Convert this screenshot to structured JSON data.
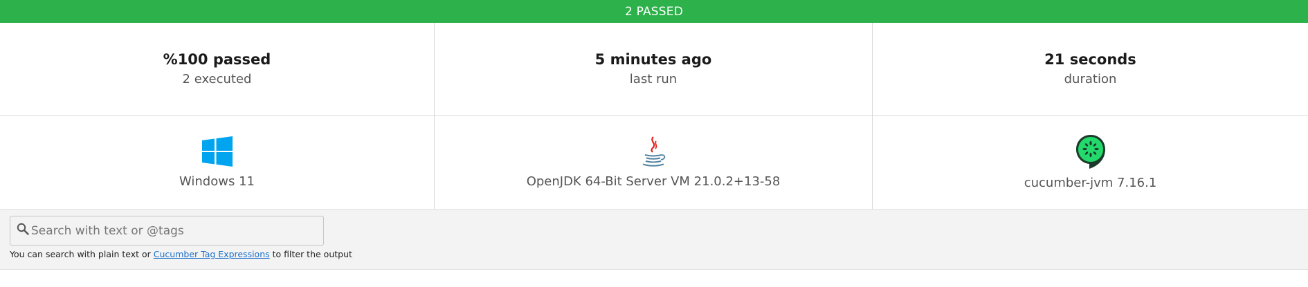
{
  "status": {
    "label": "2 PASSED",
    "color": "#2cb14b"
  },
  "summary": [
    {
      "value": "%100 passed",
      "caption": "2 executed"
    },
    {
      "value": "5 minutes ago",
      "caption": "last run"
    },
    {
      "value": "21 seconds",
      "caption": "duration"
    }
  ],
  "environment": {
    "os": {
      "label": "Windows 11",
      "icon": "windows-icon"
    },
    "runtime": {
      "label": "OpenJDK 64-Bit Server VM 21.0.2+13-58",
      "icon": "java-icon"
    },
    "implementation": {
      "label": "cucumber-jvm 7.16.1",
      "icon": "cucumber-icon"
    }
  },
  "search": {
    "placeholder": "Search with text or @tags",
    "value": "",
    "help_prefix": "You can search with plain text or ",
    "help_link": "Cucumber Tag Expressions",
    "help_suffix": " to filter the output"
  },
  "colors": {
    "passed": "#2cb14b",
    "windows": "#00a4ef",
    "cucumber": "#23d96c",
    "link": "#1a6fc9"
  }
}
